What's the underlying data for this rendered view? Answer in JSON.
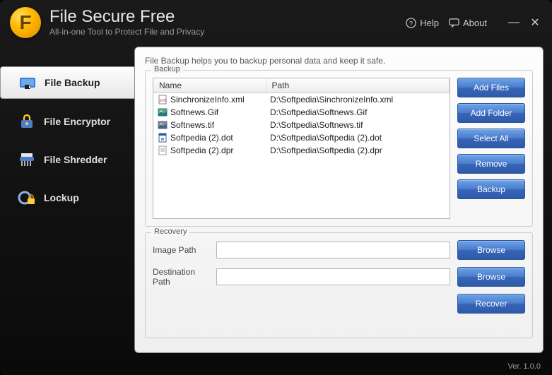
{
  "app": {
    "logo_letter": "F",
    "title": "File Secure Free",
    "subtitle": "All-in-one Tool to Protect File and Privacy"
  },
  "titlebar": {
    "help_label": "Help",
    "about_label": "About"
  },
  "sidebar": {
    "items": [
      {
        "label": "File Backup"
      },
      {
        "label": "File Encryptor"
      },
      {
        "label": "File Shredder"
      },
      {
        "label": "Lockup"
      }
    ]
  },
  "main": {
    "description": "File Backup helps you to backup personal data and keep it safe.",
    "backup": {
      "group_title": "Backup",
      "columns": {
        "name": "Name",
        "path": "Path"
      },
      "rows": [
        {
          "name": "SinchronizeInfo.xml",
          "path": "D:\\Softpedia\\SinchronizeInfo.xml"
        },
        {
          "name": "Softnews.Gif",
          "path": "D:\\Softpedia\\Softnews.Gif"
        },
        {
          "name": "Softnews.tif",
          "path": "D:\\Softpedia\\Softnews.tif"
        },
        {
          "name": "Softpedia (2).dot",
          "path": "D:\\Softpedia\\Softpedia (2).dot"
        },
        {
          "name": "Softpedia (2).dpr",
          "path": "D:\\Softpedia\\Softpedia (2).dpr"
        }
      ],
      "buttons": {
        "add_files": "Add Files",
        "add_folder": "Add Folder",
        "select_all": "Select All",
        "remove": "Remove",
        "backup": "Backup"
      }
    },
    "recovery": {
      "group_title": "Recovery",
      "image_path_label": "Image Path",
      "image_path_value": "",
      "destination_label": "Destination Path",
      "destination_value": "",
      "browse_label": "Browse",
      "recover_label": "Recover"
    }
  },
  "footer": {
    "version": "Ver. 1.0.0"
  }
}
